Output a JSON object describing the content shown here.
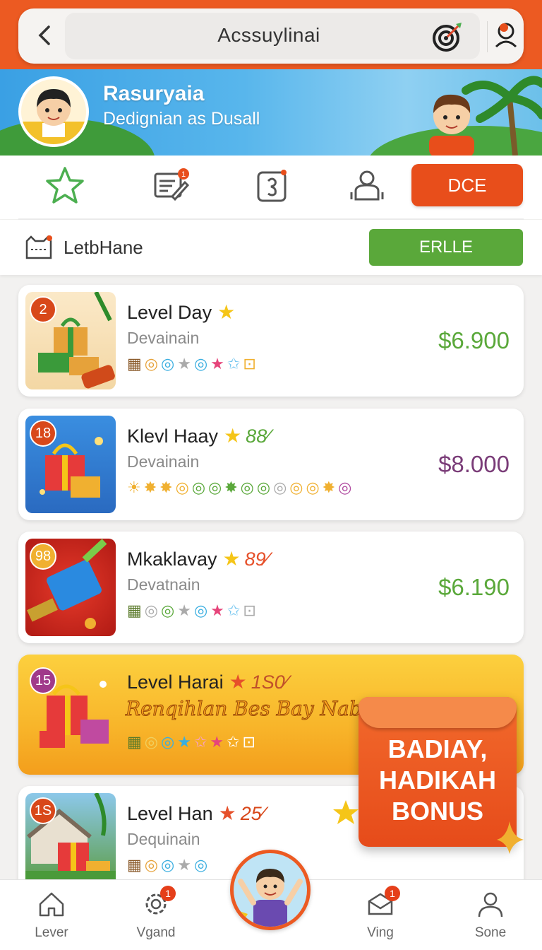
{
  "header": {
    "title": "Acssuylinai",
    "back_icon": "chevron-left-icon",
    "target_icon": "target-icon",
    "profile_icon": "profile-icon"
  },
  "banner": {
    "title": "Rasuryaia",
    "subtitle": "Dedignian as Dusall"
  },
  "actions": {
    "items": [
      {
        "icon": "star-icon"
      },
      {
        "icon": "edit-note-icon",
        "badge": "1"
      },
      {
        "icon": "tablet-icon"
      },
      {
        "icon": "user-icon"
      }
    ],
    "primary_label": "DCE"
  },
  "list_header": {
    "label": "LetbHane",
    "button_label": "ERLLE"
  },
  "cards": [
    {
      "badge": "2",
      "title": "Level Day",
      "percent": "",
      "subtitle": "Devainain",
      "price": "$6.900",
      "price_color": "#5aa83a"
    },
    {
      "badge": "18",
      "title": "Klevl Haay",
      "percent": "88⁄",
      "subtitle": "Devainain",
      "price": "$8.000",
      "price_color": "#7a3c78"
    },
    {
      "badge": "98",
      "title": "Mkaklavay",
      "percent": "89⁄",
      "subtitle": "Devatnain",
      "price": "$6.190",
      "price_color": "#5aa83a"
    }
  ],
  "promo": {
    "badge": "15",
    "title": "Level Harai",
    "percent": "1S0⁄",
    "tagline": "Renqihlan Bes Bay Nable",
    "bonus_text": "BADIAY,\nHADIKAH\nBONUS"
  },
  "last_card": {
    "badge": "1S",
    "title": "Level Han",
    "percent": "25⁄",
    "subtitle": "Dequinain"
  },
  "bottom_nav": {
    "items": [
      {
        "label": "Lever",
        "icon": "home-icon"
      },
      {
        "label": "Vgand",
        "icon": "gear-icon",
        "badge": "1"
      },
      {
        "label": "Ving",
        "icon": "mail-icon",
        "badge": "1"
      },
      {
        "label": "Sone",
        "icon": "person-icon"
      }
    ]
  },
  "colors": {
    "accent": "#ec5a22",
    "green": "#5aa83a",
    "purple_price": "#7a3c78"
  }
}
